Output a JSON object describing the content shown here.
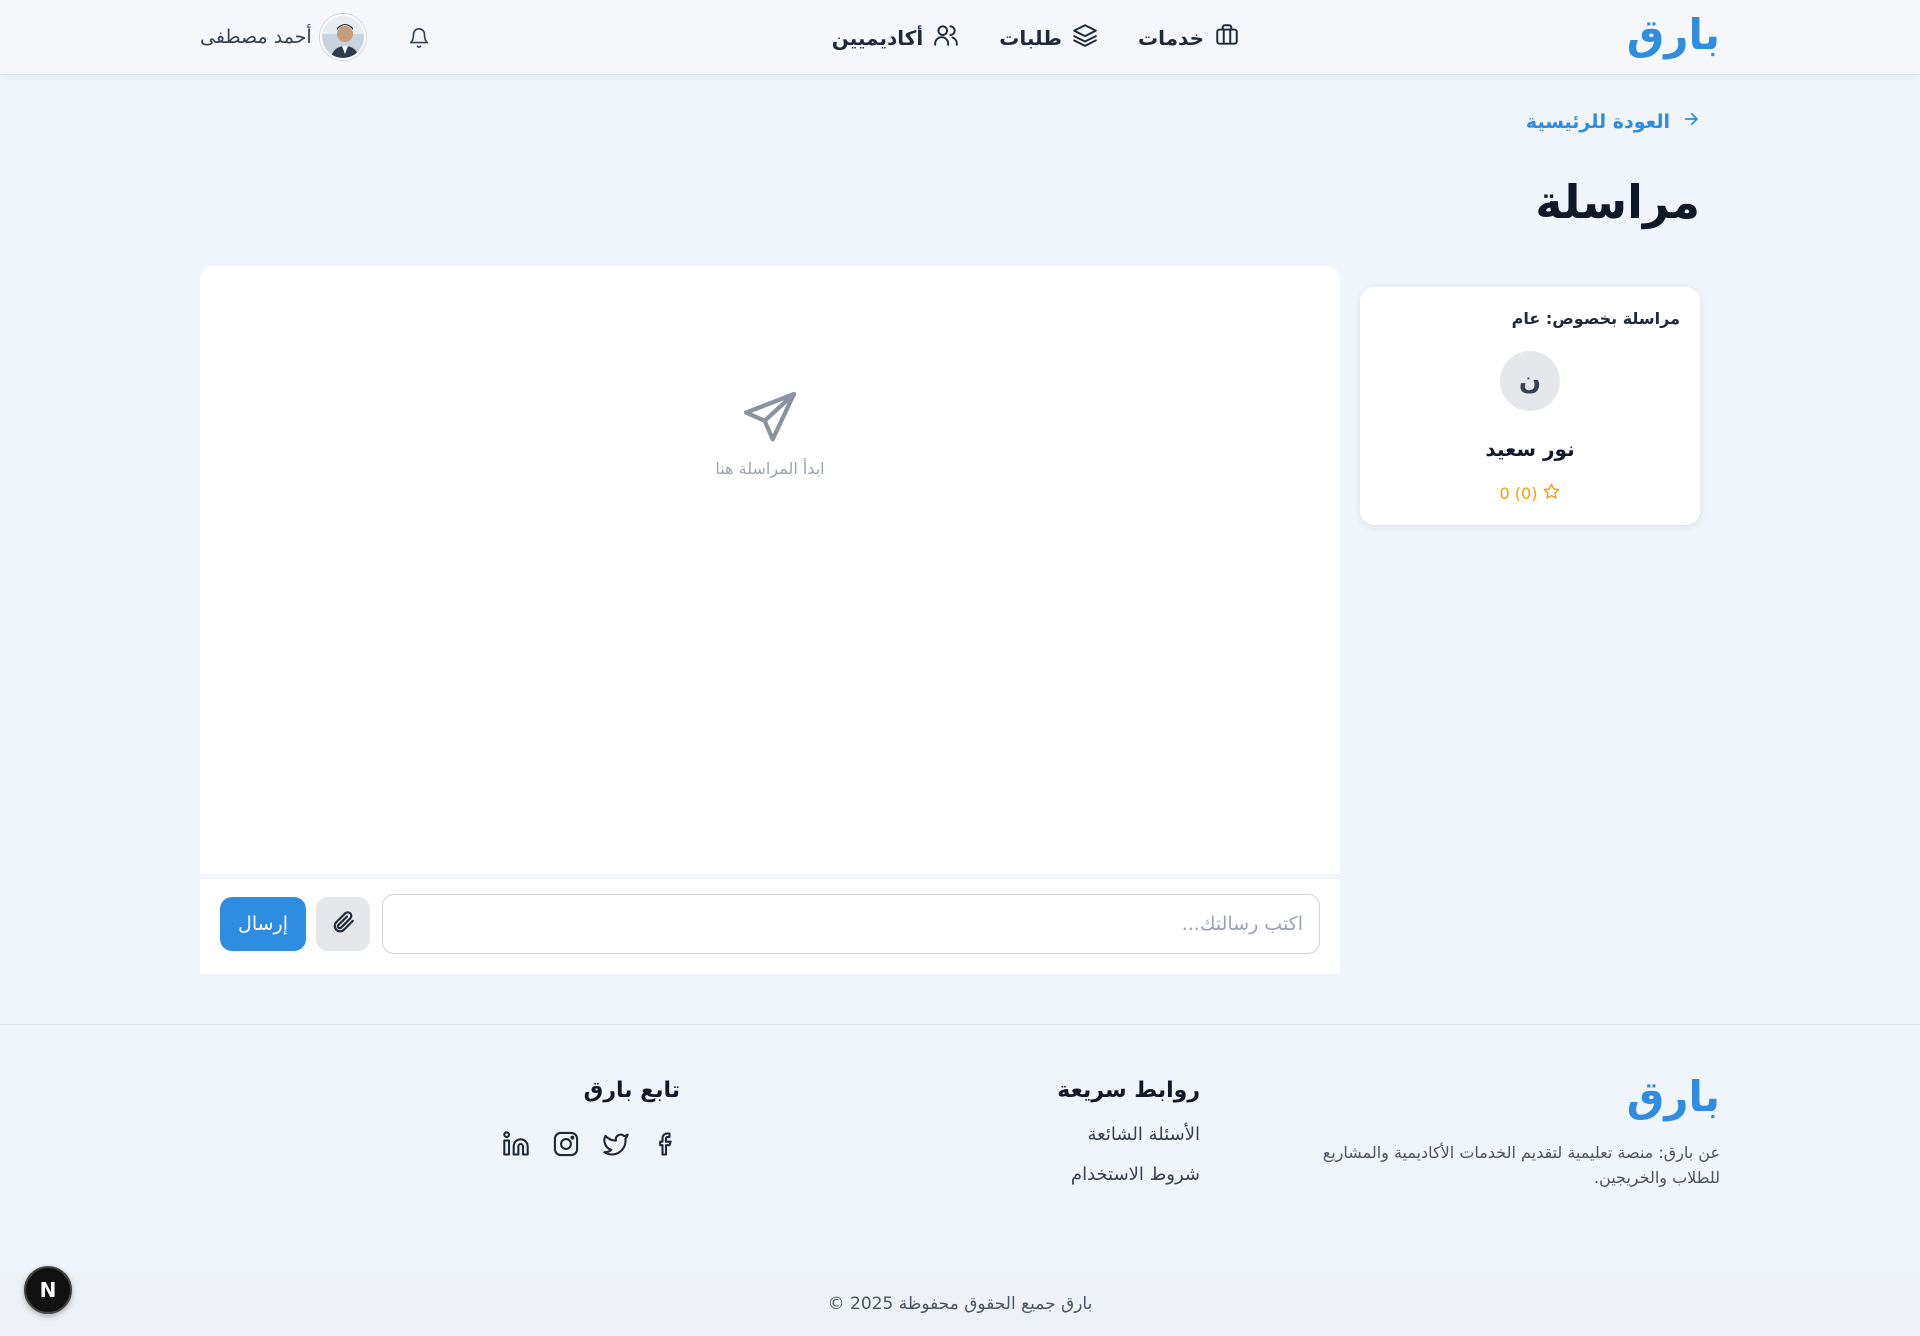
{
  "header": {
    "brand": "بارق",
    "nav": [
      {
        "label": "خدمات",
        "icon": "briefcase-icon"
      },
      {
        "label": "طلبات",
        "icon": "layers-icon"
      },
      {
        "label": "أكاديميين",
        "icon": "users-icon"
      }
    ],
    "user_name": "أحمد مصطفى",
    "notifications_icon": "bell-icon"
  },
  "back_link": "العودة للرئيسية",
  "page_title": "مراسلة",
  "conversation": {
    "subject": "مراسلة بخصوص: عام",
    "avatar_letter": "ن",
    "name": "نور سعيد",
    "rating": "0 (0)"
  },
  "chat": {
    "empty_text": "ابدأ المراسلة هنا",
    "input_placeholder": "اكتب رسالتك...",
    "send_label": "إرسال"
  },
  "footer": {
    "brand": "بارق",
    "about": "عن بارق: منصة تعليمية لتقديم الخدمات الأكاديمية والمشاريع للطلاب والخريجين.",
    "links_title": "روابط سريعة",
    "links": [
      "الأسئلة الشائعة",
      "شروط الاستخدام"
    ],
    "follow_title": "تابع بارق",
    "socials": [
      "facebook-icon",
      "twitter-icon",
      "instagram-icon",
      "linkedin-icon"
    ],
    "copyright": "© 2025 بارق جميع الحقوق محفوظة"
  },
  "dev_badge": "N",
  "colors": {
    "accent": "#2e8de0",
    "star": "#f59e0b",
    "background": "#f0f4fb"
  }
}
